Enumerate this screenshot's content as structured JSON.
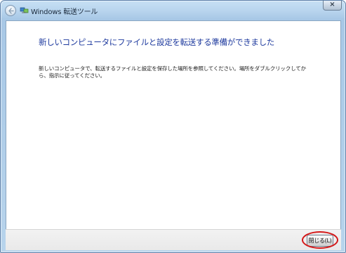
{
  "window": {
    "title": "Windows 転送ツール",
    "close_glyph": "×"
  },
  "content": {
    "heading": "新しいコンピュータにファイルと設定を転送する準備ができました",
    "body": "新しいコンピュータで、転送するファイルと設定を保存した場所を参照してください。場所をダブルクリックしてから、指示に従ってください。"
  },
  "footer": {
    "close_button_label": "閉じる(L)"
  },
  "colors": {
    "heading": "#1e3a9e",
    "highlight": "#d41818"
  },
  "icons": {
    "back": "back-arrow-icon",
    "app": "transfer-icon"
  }
}
